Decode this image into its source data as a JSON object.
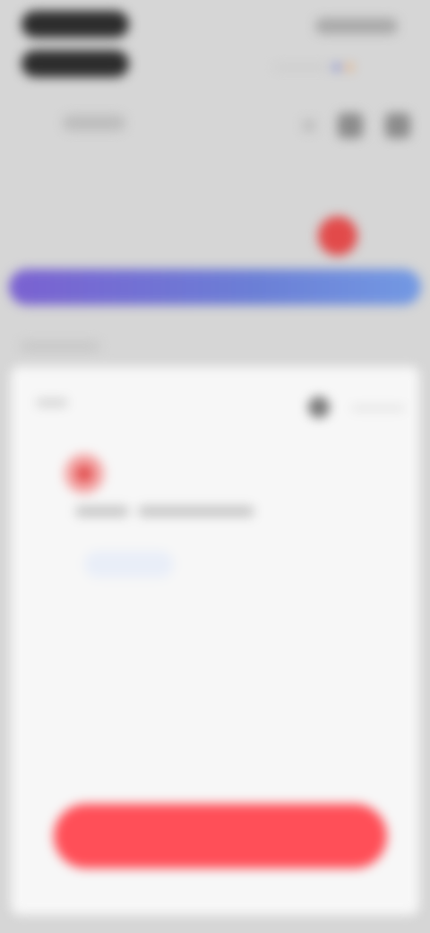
{
  "header": {
    "title_line1": "",
    "title_line2": "",
    "subtitle": "",
    "top_right_text": "",
    "icons": [
      "calendar-icon",
      "settings-icon",
      "menu-icon"
    ]
  },
  "days": [
    {
      "name": "",
      "num": "",
      "active": false
    },
    {
      "name": "",
      "num": "",
      "active": false
    },
    {
      "name": "",
      "num": "",
      "active": false
    },
    {
      "name": "",
      "num": "",
      "active": false
    },
    {
      "name": "",
      "num": "",
      "active": false
    },
    {
      "name": "",
      "num": "",
      "active": true
    },
    {
      "name": "",
      "num": "",
      "active": false
    }
  ],
  "banner": {
    "text": ""
  },
  "section": {
    "label": ""
  },
  "card": {
    "top_left_text": "",
    "habit": {
      "title": "",
      "meta_left": "",
      "meta_right": "",
      "tag": ""
    },
    "cta_label": ""
  },
  "colors": {
    "accent_red": "#ff4f58",
    "banner_start": "#7a61d1",
    "banner_end": "#7399e3",
    "active_day": "#e24a4a"
  }
}
